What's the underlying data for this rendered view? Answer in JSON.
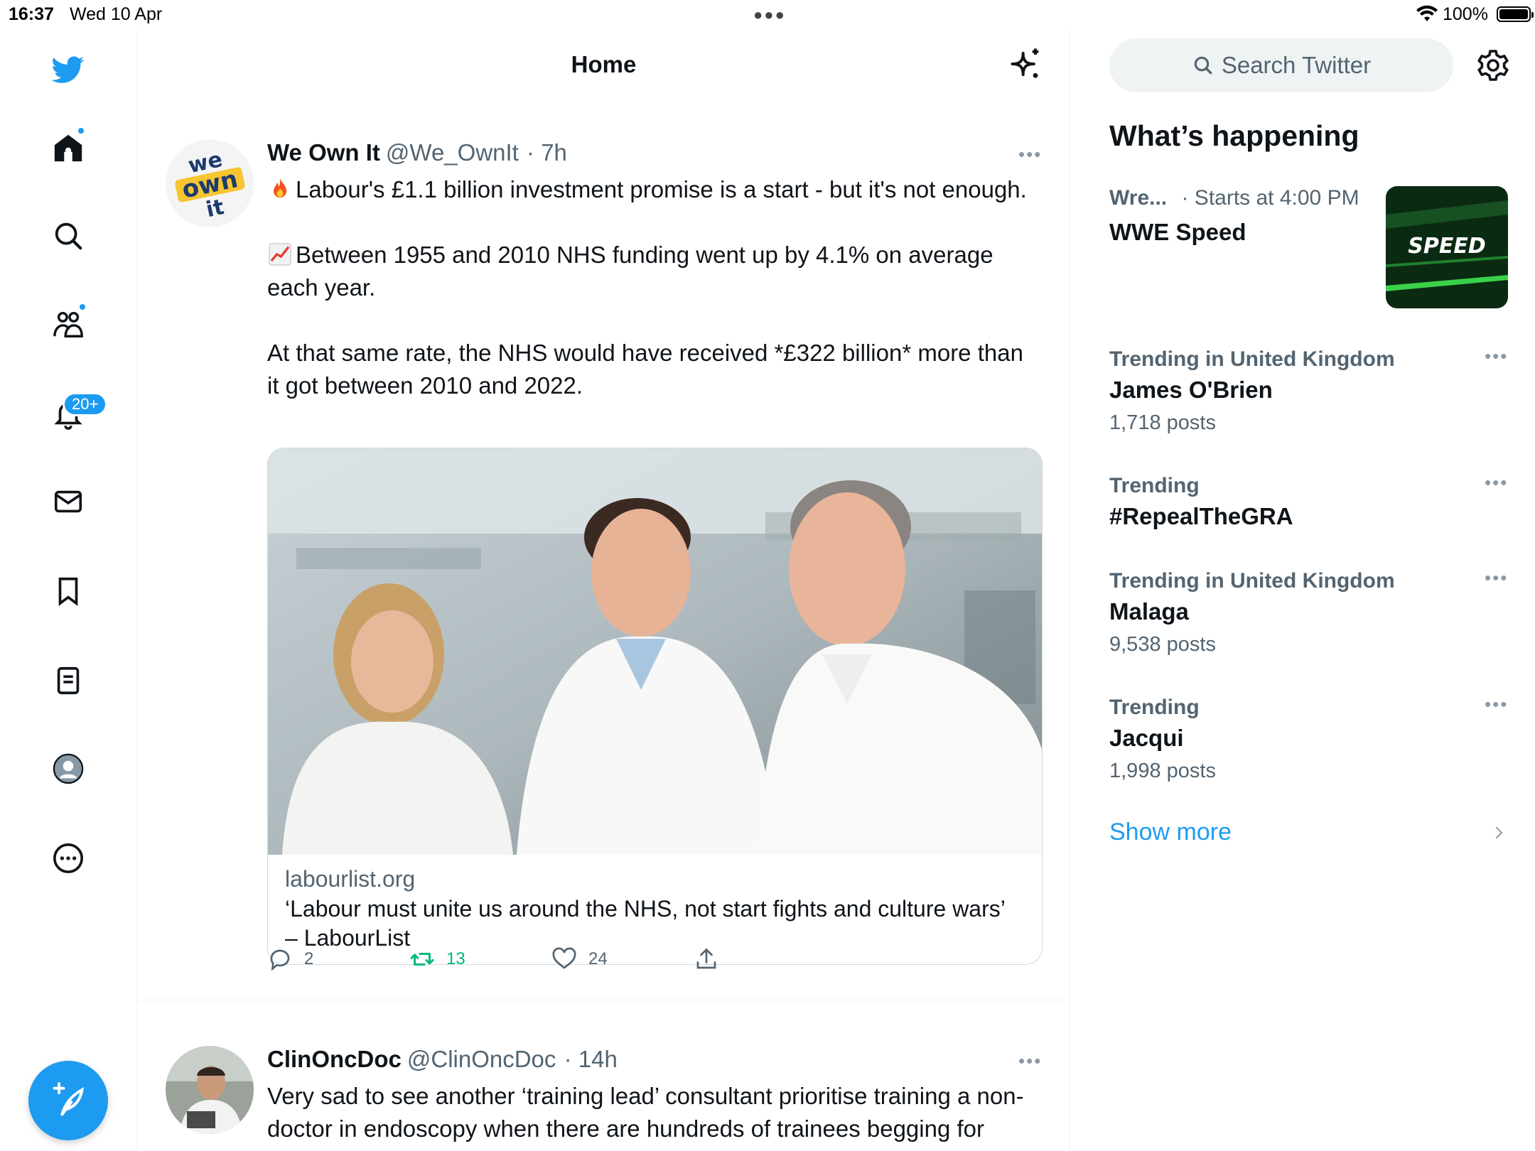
{
  "status_bar": {
    "time": "16:37",
    "date": "Wed 10 Apr",
    "battery": "100%"
  },
  "nav": {
    "notifications_badge": "20+",
    "icons": [
      "twitter-logo-icon",
      "home-icon",
      "search-icon",
      "communities-icon",
      "notifications-icon",
      "messages-icon",
      "bookmarks-icon",
      "lists-icon",
      "profile-icon",
      "more-icon",
      "compose-icon"
    ],
    "accent_color": "#1d9bf0"
  },
  "header": {
    "title": "Home"
  },
  "tweets": [
    {
      "name": "We Own It",
      "handle": "@We_OwnIt",
      "time": "· 7h",
      "avatar_lines": [
        "we",
        "own",
        "it"
      ],
      "paragraphs": [
        "Labour's £1.1 billion investment promise is a start - but it's not enough.",
        "Between 1955 and 2010 NHS funding went up by 4.1% on average each year.",
        "At that same rate, the NHS would have received *£322 billion* more than it got between 2010 and 2022."
      ],
      "card": {
        "domain": "labourlist.org",
        "title": "‘Labour must unite us around the NHS, not start fights and culture wars’ – LabourList"
      },
      "replies": "2",
      "retweets": "13",
      "likes": "24"
    },
    {
      "name": "ClinOncDoc",
      "handle": "@ClinOncDoc",
      "time": "· 14h",
      "text": "Very sad to see another ‘training lead’ consultant prioritise training a non-doctor in endoscopy when there are hundreds of trainees begging for more scope time"
    }
  ],
  "sidebar": {
    "search_placeholder": "Search Twitter",
    "whats_happening": "What’s happening",
    "event": {
      "category": "Wre...",
      "starts": "· Starts at 4:00 PM",
      "name": "WWE Speed",
      "thumb_text": "SPEED"
    },
    "trends": [
      {
        "context": "Trending in United Kingdom",
        "name": "James O'Brien",
        "posts": "1,718 posts"
      },
      {
        "context": "Trending",
        "name": "#RepealTheGRA",
        "posts": ""
      },
      {
        "context": "Trending in United Kingdom",
        "name": "Malaga",
        "posts": "9,538 posts"
      },
      {
        "context": "Trending",
        "name": "Jacqui",
        "posts": "1,998 posts"
      }
    ],
    "show_more": "Show more"
  }
}
